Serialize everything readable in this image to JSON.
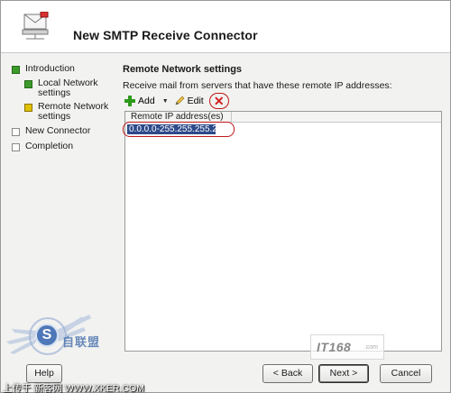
{
  "window": {
    "title": "New SMTP Receive Connector"
  },
  "steps": [
    {
      "label": "Introduction",
      "state": "complete"
    },
    {
      "label": "Local Network settings",
      "state": "complete"
    },
    {
      "label": "Remote Network settings",
      "state": "current"
    },
    {
      "label": "New Connector",
      "state": "pending"
    },
    {
      "label": "Completion",
      "state": "pending"
    }
  ],
  "section": {
    "title": "Remote Network settings",
    "description": "Receive mail from servers that have these remote IP addresses:"
  },
  "toolbar": {
    "add_label": "Add",
    "edit_label": "Edit",
    "delete_icon": "close-icon"
  },
  "list": {
    "column_header": "Remote IP address(es)",
    "rows": [
      "0.0.0.0-255.255.255.255"
    ]
  },
  "buttons": {
    "help": "Help",
    "back": "Back",
    "next": "Next",
    "cancel": "Cancel"
  },
  "watermark": {
    "logo_text": "IT168",
    "logo_sub": ".com",
    "badge_letter": "S",
    "badge_cn": "自联盟",
    "footer": "上传于 新客网 WWW.XKER.COM"
  },
  "colors": {
    "complete": "#3c9a2a",
    "current": "#e0c000",
    "selection": "#2d4a8a",
    "annotation": "#c01818"
  }
}
